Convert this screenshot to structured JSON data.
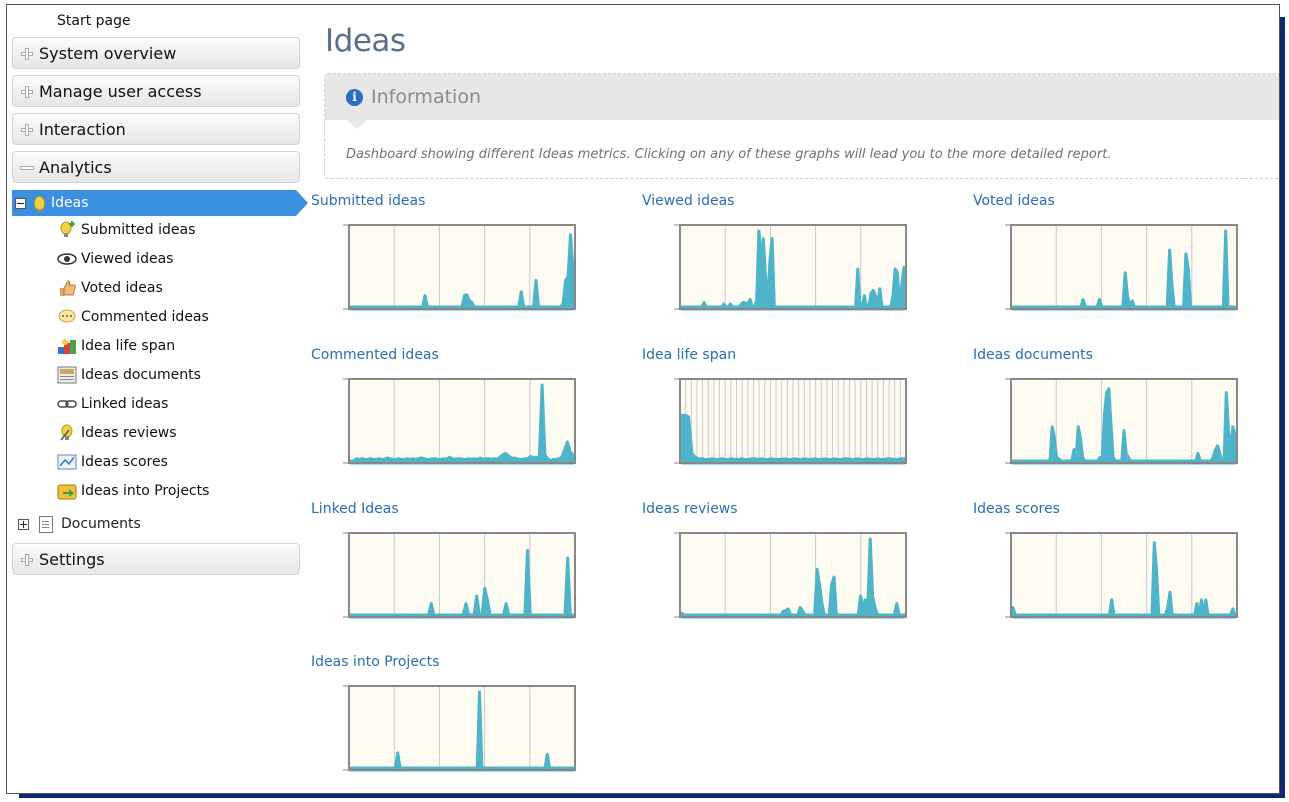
{
  "sidebar": {
    "start_page": "Start page",
    "sections": [
      {
        "label": "System overview",
        "expanded": false
      },
      {
        "label": "Manage user access",
        "expanded": false
      },
      {
        "label": "Interaction",
        "expanded": false
      },
      {
        "label": "Analytics",
        "expanded": true
      }
    ],
    "ideas_node": {
      "label": "Ideas",
      "icon": "lightbulb-icon",
      "selected": true
    },
    "ideas_children": [
      {
        "label": "Submitted ideas",
        "icon": "lightbulb-plus-icon"
      },
      {
        "label": "Viewed ideas",
        "icon": "eye-icon"
      },
      {
        "label": "Voted ideas",
        "icon": "thumbs-up-icon"
      },
      {
        "label": "Commented ideas",
        "icon": "comment-icon"
      },
      {
        "label": "Idea life span",
        "icon": "lifespan-icon"
      },
      {
        "label": "Ideas documents",
        "icon": "document-icon"
      },
      {
        "label": "Linked ideas",
        "icon": "link-icon"
      },
      {
        "label": "Ideas reviews",
        "icon": "review-icon"
      },
      {
        "label": "Ideas scores",
        "icon": "score-icon"
      },
      {
        "label": "Ideas into Projects",
        "icon": "project-icon"
      }
    ],
    "documents_node": {
      "label": "Documents",
      "icon": "documents-icon"
    },
    "settings": {
      "label": "Settings"
    }
  },
  "main": {
    "title": "Ideas",
    "info": {
      "heading": "Information",
      "text": "Dashboard showing different Ideas metrics. Clicking on any of these graphs will lead you to the more detailed report."
    }
  },
  "colors": {
    "series": "#4eb4c9",
    "plot_bg": "#fefcf2",
    "link": "#2a6db3",
    "selected": "#3a8fe0"
  },
  "chart_data": [
    {
      "title": "Submitted ideas",
      "type": "area",
      "grid_v": 5,
      "ylim": [
        0,
        100
      ],
      "values": [
        0,
        0,
        0,
        0,
        0,
        0,
        0,
        0,
        0,
        0,
        0,
        0,
        0,
        0,
        0,
        0,
        0,
        0,
        0,
        0,
        0,
        0,
        0,
        0,
        0,
        0,
        0,
        0,
        0,
        0,
        15,
        0,
        0,
        0,
        0,
        0,
        0,
        0,
        0,
        0,
        0,
        0,
        0,
        0,
        0,
        0,
        15,
        16,
        8,
        6,
        0,
        0,
        0,
        0,
        0,
        0,
        0,
        0,
        0,
        0,
        0,
        0,
        0,
        0,
        0,
        0,
        0,
        0,
        0,
        20,
        0,
        0,
        0,
        0,
        0,
        35,
        0,
        0,
        0,
        0,
        0,
        0,
        0,
        0,
        0,
        0,
        5,
        35,
        40,
        95,
        50
      ]
    },
    {
      "title": "Viewed ideas",
      "type": "area",
      "grid_v": 5,
      "ylim": [
        0,
        100
      ],
      "values": [
        0,
        0,
        0,
        0,
        0,
        0,
        0,
        0,
        0,
        0,
        6,
        0,
        0,
        0,
        0,
        0,
        0,
        0,
        0,
        4,
        0,
        0,
        4,
        0,
        0,
        0,
        0,
        4,
        6,
        5,
        4,
        10,
        0,
        0,
        8,
        100,
        60,
        90,
        40,
        8,
        60,
        90,
        0,
        0,
        0,
        0,
        0,
        0,
        0,
        0,
        0,
        0,
        0,
        0,
        0,
        0,
        0,
        0,
        0,
        0,
        0,
        0,
        0,
        0,
        0,
        0,
        0,
        0,
        0,
        0,
        0,
        0,
        0,
        0,
        0,
        0,
        0,
        0,
        0,
        0,
        50,
        0,
        0,
        15,
        0,
        0,
        18,
        22,
        15,
        0,
        24,
        0,
        0,
        0,
        0,
        0,
        15,
        50,
        45,
        0,
        30,
        52
      ]
    },
    {
      "title": "Voted ideas",
      "type": "area",
      "grid_v": 5,
      "ylim": [
        0,
        100
      ],
      "values": [
        0,
        0,
        0,
        0,
        0,
        0,
        0,
        0,
        0,
        0,
        0,
        0,
        0,
        0,
        0,
        0,
        0,
        0,
        0,
        0,
        0,
        0,
        0,
        0,
        0,
        0,
        0,
        0,
        0,
        0,
        10,
        0,
        0,
        0,
        0,
        0,
        0,
        10,
        0,
        0,
        0,
        0,
        0,
        0,
        0,
        0,
        0,
        0,
        45,
        15,
        0,
        8,
        0,
        0,
        0,
        0,
        0,
        0,
        0,
        0,
        0,
        0,
        0,
        0,
        0,
        0,
        0,
        75,
        30,
        0,
        0,
        0,
        0,
        0,
        70,
        50,
        0,
        0,
        0,
        0,
        0,
        0,
        0,
        0,
        0,
        0,
        0,
        0,
        0,
        0,
        0,
        100,
        0,
        0,
        0,
        0
      ]
    },
    {
      "title": "Commented ideas",
      "type": "area",
      "grid_v": 5,
      "ylim": [
        0,
        100
      ],
      "values": [
        0,
        0,
        3,
        2,
        3,
        2,
        2,
        3,
        2,
        2,
        3,
        2,
        2,
        4,
        3,
        2,
        2,
        3,
        2,
        2,
        3,
        2,
        3,
        2,
        3,
        4,
        3,
        2,
        2,
        3,
        3,
        2,
        2,
        3,
        2,
        5,
        3,
        2,
        3,
        3,
        2,
        2,
        3,
        2,
        3,
        2,
        4,
        2,
        3,
        3,
        2,
        3,
        2,
        5,
        8,
        10,
        7,
        4,
        4,
        3,
        2,
        2,
        3,
        3,
        6,
        4,
        5,
        3,
        100,
        8,
        3,
        0,
        2,
        2,
        3,
        5,
        15,
        25,
        12,
        8
      ]
    },
    {
      "title": "Idea life span",
      "type": "area",
      "grid_v": 40,
      "ylim": [
        0,
        100
      ],
      "values": [
        60,
        60,
        58,
        10,
        5,
        3,
        3,
        2,
        2,
        3,
        2,
        2,
        3,
        2,
        2,
        3,
        2,
        2,
        3,
        2,
        2,
        3,
        3,
        2,
        3,
        2,
        2,
        3,
        2,
        2,
        2,
        3,
        2,
        2,
        3,
        2,
        2,
        3,
        2,
        2,
        3,
        2,
        2,
        3,
        2,
        2,
        3,
        2,
        2,
        3,
        3,
        2,
        2,
        3,
        2,
        2,
        3,
        2,
        2,
        3,
        2,
        2,
        3,
        3,
        2,
        2,
        3,
        3
      ]
    },
    {
      "title": "Ideas documents",
      "type": "area",
      "grid_v": 5,
      "ylim": [
        0,
        100
      ],
      "values": [
        0,
        0,
        0,
        0,
        0,
        0,
        0,
        0,
        0,
        0,
        0,
        0,
        0,
        0,
        0,
        0,
        0,
        0,
        45,
        30,
        5,
        3,
        0,
        0,
        0,
        0,
        0,
        0,
        15,
        5,
        45,
        30,
        5,
        0,
        0,
        0,
        0,
        0,
        0,
        0,
        5,
        0,
        60,
        90,
        95,
        50,
        5,
        0,
        0,
        0,
        0,
        40,
        10,
        5,
        0,
        0,
        0,
        0,
        0,
        0,
        0,
        0,
        0,
        0,
        0,
        0,
        0,
        0,
        0,
        0,
        0,
        0,
        0,
        0,
        0,
        0,
        0,
        0,
        0,
        0,
        0,
        0,
        0,
        0,
        0,
        10,
        0,
        0,
        0,
        0,
        0,
        0,
        5,
        15,
        20,
        10,
        0,
        0,
        90,
        40,
        10,
        45,
        35
      ]
    },
    {
      "title": "Linked Ideas",
      "type": "area",
      "grid_v": 5,
      "ylim": [
        0,
        100
      ],
      "values": [
        0,
        0,
        0,
        0,
        0,
        0,
        0,
        0,
        0,
        0,
        0,
        0,
        0,
        0,
        0,
        0,
        0,
        0,
        0,
        0,
        0,
        0,
        0,
        0,
        0,
        0,
        0,
        0,
        0,
        0,
        15,
        0,
        0,
        0,
        0,
        0,
        0,
        0,
        0,
        0,
        0,
        0,
        0,
        15,
        0,
        0,
        0,
        25,
        0,
        0,
        35,
        20,
        0,
        0,
        0,
        0,
        0,
        0,
        15,
        0,
        0,
        0,
        0,
        0,
        0,
        0,
        85,
        0,
        0,
        0,
        0,
        0,
        0,
        0,
        0,
        0,
        0,
        0,
        0,
        0,
        0,
        75,
        0,
        0
      ]
    },
    {
      "title": "Ideas reviews",
      "type": "area",
      "grid_v": 5,
      "ylim": [
        0,
        100
      ],
      "values": [
        2,
        0,
        0,
        0,
        0,
        0,
        0,
        0,
        0,
        0,
        0,
        0,
        0,
        0,
        0,
        0,
        0,
        0,
        0,
        0,
        0,
        0,
        0,
        0,
        0,
        0,
        0,
        0,
        0,
        0,
        0,
        0,
        0,
        0,
        0,
        0,
        0,
        0,
        0,
        0,
        0,
        0,
        5,
        6,
        8,
        0,
        0,
        0,
        0,
        10,
        5,
        0,
        0,
        0,
        0,
        0,
        60,
        40,
        15,
        0,
        0,
        0,
        40,
        50,
        0,
        0,
        0,
        0,
        0,
        0,
        0,
        0,
        0,
        0,
        25,
        10,
        20,
        10,
        100,
        25,
        10,
        0,
        0,
        0,
        0,
        0,
        0,
        0,
        0,
        15,
        0,
        0,
        0
      ]
    },
    {
      "title": "Ideas scores",
      "type": "area",
      "grid_v": 5,
      "ylim": [
        0,
        100
      ],
      "values": [
        10,
        0,
        0,
        0,
        0,
        0,
        0,
        0,
        0,
        0,
        0,
        0,
        0,
        0,
        0,
        0,
        0,
        0,
        0,
        0,
        0,
        0,
        0,
        0,
        0,
        0,
        0,
        0,
        0,
        0,
        0,
        0,
        0,
        0,
        0,
        0,
        0,
        0,
        0,
        0,
        0,
        0,
        0,
        0,
        20,
        0,
        0,
        0,
        0,
        0,
        0,
        0,
        0,
        0,
        0,
        0,
        0,
        0,
        0,
        0,
        0,
        0,
        0,
        95,
        60,
        0,
        0,
        0,
        0,
        10,
        30,
        0,
        0,
        0,
        0,
        0,
        0,
        0,
        0,
        0,
        0,
        0,
        15,
        0,
        20,
        0,
        20,
        0,
        0,
        0,
        0,
        0,
        0,
        0,
        0,
        0,
        0,
        0,
        8,
        0
      ]
    },
    {
      "title": "Ideas into Projects",
      "type": "area",
      "grid_v": 5,
      "ylim": [
        0,
        100
      ],
      "values": [
        0,
        0,
        0,
        0,
        0,
        0,
        0,
        0,
        0,
        0,
        0,
        0,
        0,
        0,
        0,
        0,
        0,
        0,
        0,
        0,
        20,
        0,
        0,
        0,
        0,
        0,
        0,
        0,
        0,
        0,
        0,
        0,
        0,
        0,
        0,
        0,
        0,
        0,
        0,
        0,
        0,
        0,
        0,
        0,
        0,
        0,
        0,
        0,
        0,
        0,
        0,
        0,
        0,
        0,
        0,
        100,
        0,
        0,
        0,
        0,
        0,
        0,
        0,
        0,
        0,
        0,
        0,
        0,
        0,
        0,
        0,
        0,
        0,
        0,
        0,
        0,
        0,
        0,
        0,
        0,
        0,
        0,
        0,
        0,
        18,
        0,
        0,
        0,
        0,
        0,
        0,
        0,
        0,
        0,
        0,
        0
      ]
    }
  ]
}
